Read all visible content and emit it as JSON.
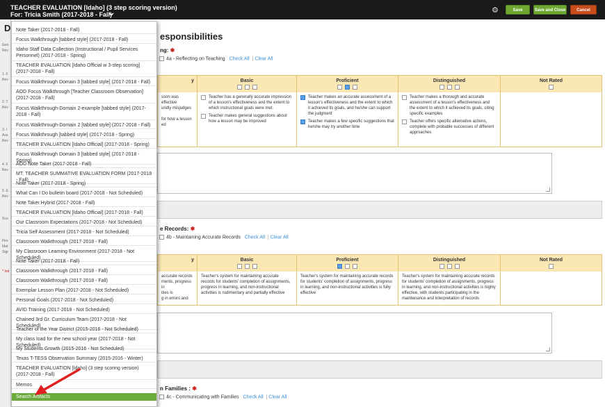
{
  "header": {
    "title": "TEACHER EVALUATION [Idaho] (3 step scoring version)",
    "subtitle": "For: Tricia Smith (2017-2018 - Fall)",
    "save_label": "Save",
    "save_close_label": "Save and Close",
    "cancel_label": "Cancel"
  },
  "page": {
    "heading_char": "D",
    "section_title": "esponsibilities"
  },
  "left_sidebar": {
    "items": [
      "Gen",
      "Rev",
      "1. F",
      "Rev",
      "2. T",
      "Rev",
      "3. I",
      "Ass",
      "Rev",
      "4. F",
      "Rev",
      "5. E",
      "Rev",
      "Sco",
      "Fire",
      "Mat",
      "Sigr",
      "* Ind"
    ]
  },
  "sections": [
    {
      "heading": "ng:",
      "component_label": "4a - Reflecting on Teaching",
      "check_all": "Check All",
      "clear_all": "Clear All",
      "levels": [
        "y",
        "Basic",
        "Proficient",
        "Distinguished",
        "Not Rated"
      ],
      "cells": [
        [
          "sson was effective",
          "undly misjudges",
          "",
          "for how a lesson",
          "ed"
        ],
        [
          "Teacher has a generally accurate impression of a lesson's effectiveness and the extent to which instructional goals were met.",
          "Teacher makes general suggestions about how a lesson may be improved"
        ],
        [
          "Teacher makes an accurate assessment of a lesson's effectiveness and the extent to which it achieved its goals, and he/she can support the judgment",
          "Teacher makes a few specific suggestions that he/she may try another time"
        ],
        [
          "Teacher makes a thorough and accurate assessment of a lesson's effectiveness and the extent to which it achieved its goals, citing specific examples",
          "Teacher offers specific alternative actions, complete with probable successes of different approaches"
        ]
      ]
    },
    {
      "heading": "e Records:",
      "component_label": "4b - Maintaining Accurate Records",
      "check_all": "Check All",
      "clear_all": "Clear All",
      "levels": [
        "y",
        "Basic",
        "Proficient",
        "Distinguished",
        "Not Rated"
      ],
      "cells": [
        [
          "accurate records",
          "ments, progress in",
          "ities is",
          "g in errors and"
        ],
        [
          "Teacher's system for maintaining accurate records for students' completion of assignments, progress in learning, and non-instructional activities is rudimentary and partially effective"
        ],
        [
          "Teacher's system for maintaining accurate records for students' completion of assignments, progress in learning, and non-instructional activities is fully effective"
        ],
        [
          "Teacher's system for maintaining accurate records for students' completion of assignments, progress in learning, and non-instructional activities is highly effective, with students participating in the maintenance and interpretation of records"
        ]
      ]
    },
    {
      "heading": "n Families :",
      "component_label": "4c - Communicating with Families",
      "check_all": "Check All",
      "clear_all": "Clear All"
    }
  ],
  "dropdown": {
    "items": [
      "Note Taker (2017-2018 - Fall)",
      "Focus Walkthrough [tabbed style] (2017-2018 - Fall)",
      "Idaho Staff Data Collection (Instructional / Pupil Services Personnel) (2017-2018 - Spring)",
      "TEACHER EVALUATION [Idaho Official w 3-step scoring] (2017-2018 - Fall)",
      "Focus Walkthrough Domain 3 [tabbed style] (2017-2018 - Fall)",
      "AOD Focus Walkthrough [Teacher Classroom Observation] (2017-2018 - Fall)",
      "Focus Walkthrough-Domain 2-example [tabbed style] (2017-2018 - Fall)",
      "Focus Walkthrough-Domain 2 [tabbed style] (2017-2018 - Fall)",
      "Focus Walkthrough [tabbed style] (2017-2018 - Spring)",
      "TEACHER EVALUATION [Idaho Official] (2017-2018 - Spring)",
      "Focus Walkthrough Domain 3 [tabbed style] (2017-2018 - Spring)",
      "AOD Note Taker (2017-2018 - Fall)",
      "MT. TEACHER SUMMATIVE EVALUATION FORM (2017-2018 - Fall)",
      "Note Taker (2017-2018 - Spring)",
      "What Can I Do bulletin board (2017-2018 - Not Scheduled)",
      "Note Taker Hybrid (2017-2018 - Fall)",
      "TEACHER EVALUATION [Idaho Official] (2017-2018 - Fall)",
      "Our Classroom Expectations (2017-2018 - Not Scheduled)",
      "Tricia Self Assessment (2017-2018 - Not Scheduled)",
      "Classroom Walkthrough (2017-2018 - Fall)",
      "My Classroom Learning Environment (2017-2018 - Not Scheduled)",
      "Note Taker (2017-2018 - Fall)",
      "Classroom Walkthrough (2017-2018 - Fall)",
      "Classroom Walkthrough (2017-2018 - Fall)",
      "Exemplar Lesson Plan (2017-2018 - Not Scheduled)",
      "Personal Goals (2017-2018 - Not Scheduled)",
      "AVID Training (2017-2018 - Not Scheduled)",
      "Chained 3rd Gr. Curriculum Team (2017-2018 - Not Scheduled)",
      "Teacher of the Year District (2015-2016 - Not Scheduled)",
      "My class load for the new school year (2017-2018 - Not Scheduled)",
      "My Students Growth (2015-2016 - Not Scheduled)",
      "Texas T-TESS Observation Summary (2015-2016 - Winter)",
      "TEACHER EVALUATION [Idaho] (3 step scoring version) (2017-2018 - Fall)",
      "Memos",
      "Search Artifacts"
    ]
  },
  "colors": {
    "topbar": "#1a1a1a",
    "save_green": "#6ea833",
    "cancel_red": "#c84b1c",
    "rubric_header": "#fbe7b4",
    "active_item": "#6aab3c",
    "arrow": "#e02020"
  }
}
